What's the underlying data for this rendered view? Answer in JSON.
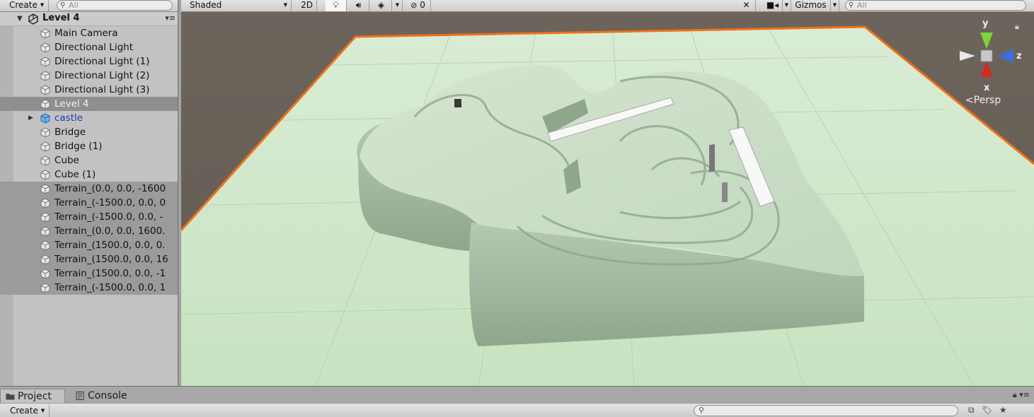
{
  "hierarchy": {
    "create_label": "Create",
    "search_placeholder": "All",
    "scene_name": "Level 4",
    "items": [
      {
        "label": "Main Camera"
      },
      {
        "label": "Directional Light"
      },
      {
        "label": "Directional Light (1)"
      },
      {
        "label": "Directional Light (2)"
      },
      {
        "label": "Directional Light (3)"
      },
      {
        "label": "Level 4"
      },
      {
        "label": "castle"
      },
      {
        "label": "Bridge"
      },
      {
        "label": "Bridge (1)"
      },
      {
        "label": "Cube"
      },
      {
        "label": "Cube (1)"
      },
      {
        "label": "Terrain_(0.0, 0.0, -1600"
      },
      {
        "label": "Terrain_(-1500.0, 0.0, 0"
      },
      {
        "label": "Terrain_(-1500.0, 0.0, -"
      },
      {
        "label": "Terrain_(0.0, 0.0, 1600."
      },
      {
        "label": "Terrain_(1500.0, 0.0, 0."
      },
      {
        "label": "Terrain_(1500.0, 0.0, 16"
      },
      {
        "label": "Terrain_(1500.0, 0.0, -1"
      },
      {
        "label": "Terrain_(-1500.0, 0.0, 1"
      }
    ]
  },
  "scene_toolbar": {
    "shading_mode": "Shaded",
    "mode_2d": "2D",
    "hidden_count": "0",
    "gizmos_label": "Gizmos",
    "search_placeholder": "All"
  },
  "gizmo": {
    "axis_y": "y",
    "axis_z": "z",
    "axis_x": "x",
    "projection": "Persp"
  },
  "bottom": {
    "tab_project": "Project",
    "tab_console": "Console",
    "create_label": "Create"
  },
  "colors": {
    "ground": "#cde5c8",
    "terrain": "#c6d9c3",
    "selection_outline": "#f07018",
    "sky": "#686159"
  }
}
